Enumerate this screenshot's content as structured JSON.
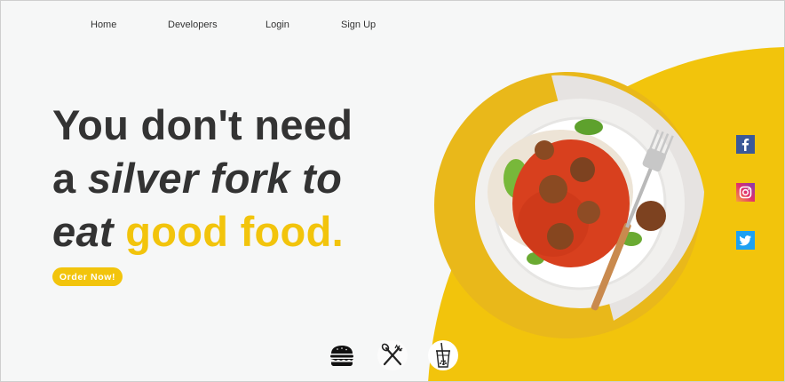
{
  "nav": {
    "items": [
      {
        "label": "Home"
      },
      {
        "label": "Developers"
      },
      {
        "label": "Login"
      },
      {
        "label": "Sign Up"
      }
    ]
  },
  "hero": {
    "line1": "You don't need",
    "line2_start": "a ",
    "line2_em": "silver fork to",
    "line3_em": "eat",
    "line3_space": " ",
    "line3_highlight": "good food."
  },
  "cta": {
    "label": "Order Now!"
  },
  "social": {
    "icons": [
      "facebook-icon",
      "instagram-icon",
      "twitter-icon"
    ]
  },
  "categories": {
    "icons": [
      "burger-icon",
      "cutlery-icon",
      "bubble-tea-icon"
    ]
  },
  "colors": {
    "accent": "#f2c40c",
    "background": "#f6f7f7",
    "text": "#333333",
    "facebook": "#3b5998",
    "twitter": "#1da1f2"
  }
}
